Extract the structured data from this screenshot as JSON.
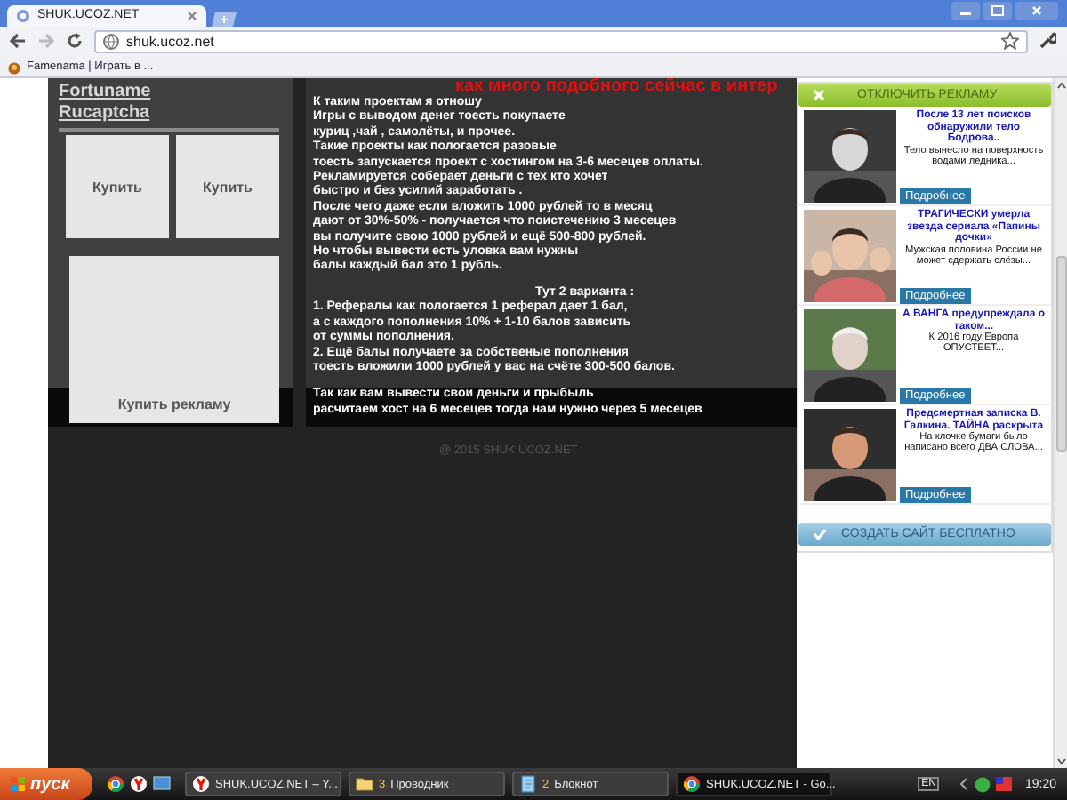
{
  "browser": {
    "tab": {
      "title": "SHUK.UCOZ.NET"
    },
    "address": "shuk.ucoz.net",
    "bookmarks": [
      "Famenama | Играть в ..."
    ]
  },
  "site": {
    "heading": "как много подобного сейчас в интер",
    "links": [
      "Fortuname",
      "Rucaptcha"
    ],
    "buy_buttons": [
      "Купить",
      "Купить"
    ],
    "ad_button": "Купить рекламу",
    "intro": "К таким проектам я отношу\nИгры с выводом денег тоесть покупаете\nкуриц ,чай , самолёты, и прочее.\nТакие проекты как пологается разовые\nтоесть запускается проект с хостингом на 3-6 месецев оплаты.\nРекламируется соберает деньги с тех кто хочет\nбыстро и без усилий заработать .\nПосле чего даже если вложить 1000 рублей то в месяц\nдают от 30%-50% - получается что поистечению 3 месецев\nвы получите свою 1000 рублей и ещё 500-800 рублей.\nНо чтобы вывести есть уловка вам нужны\nбалы каждый бал это 1 рубль.",
    "options_title": "Тут 2 варианта :",
    "options": "1. Рефералы как пологается 1 реферал дает 1 бал,\nа с каждого пополнения 10% + 1-10 балов зависить\nот суммы пополнения.\n2. Ещё балы получаете за собственые пополнения\nтоесть вложили 1000 рублей у вас на счёте 300-500 балов.",
    "band_text": "Так как вам вывести свои деньги и прыбыль\nрасчитаем хост на 6 месецев тогда нам нужно через 5 месецев",
    "footer": "@ 2015 SHUK.UCOZ.NET"
  },
  "ad_panel": {
    "close_label": "ОТКЛЮЧИТЬ РЕКЛАМУ",
    "items": [
      {
        "title": "После 13 лет поисков обнаружили тело Бодрова..",
        "text": "Тело вынесло на поверхность водами ледника...",
        "button": "Подробнее"
      },
      {
        "title": "ТРАГИЧЕСКИ умерла звезда сериала «Папины дочки»",
        "text": "Мужская половина России не может сдержать слёзы...",
        "button": "Подробнее"
      },
      {
        "title": "А ВАНГА предупреждала о таком...",
        "text": "К 2016 году Европа ОПУСТЕЕТ...",
        "button": "Подробнее"
      },
      {
        "title": "Предсмертная записка В. Галкина. ТАЙНА раскрыта",
        "text": "На клочке бумаги было написано всего ДВА СЛОВА...",
        "button": "Подробнее"
      }
    ],
    "create_label": "СОЗДАТЬ САЙТ БЕСПЛАТНО"
  },
  "taskbar": {
    "start": "пуск",
    "tasks": [
      {
        "kind": "yandex",
        "label": "SHUK.UCOZ.NET – Y...",
        "selected": false
      },
      {
        "kind": "folder",
        "count": "3",
        "label": "Проводник",
        "selected": false
      },
      {
        "kind": "notepad",
        "count": "2",
        "label": "Блокнот",
        "selected": false
      },
      {
        "kind": "chrome",
        "label": "SHUK.UCOZ.NET - Go...",
        "selected": true
      }
    ],
    "lang": "EN",
    "clock": "19:20"
  }
}
